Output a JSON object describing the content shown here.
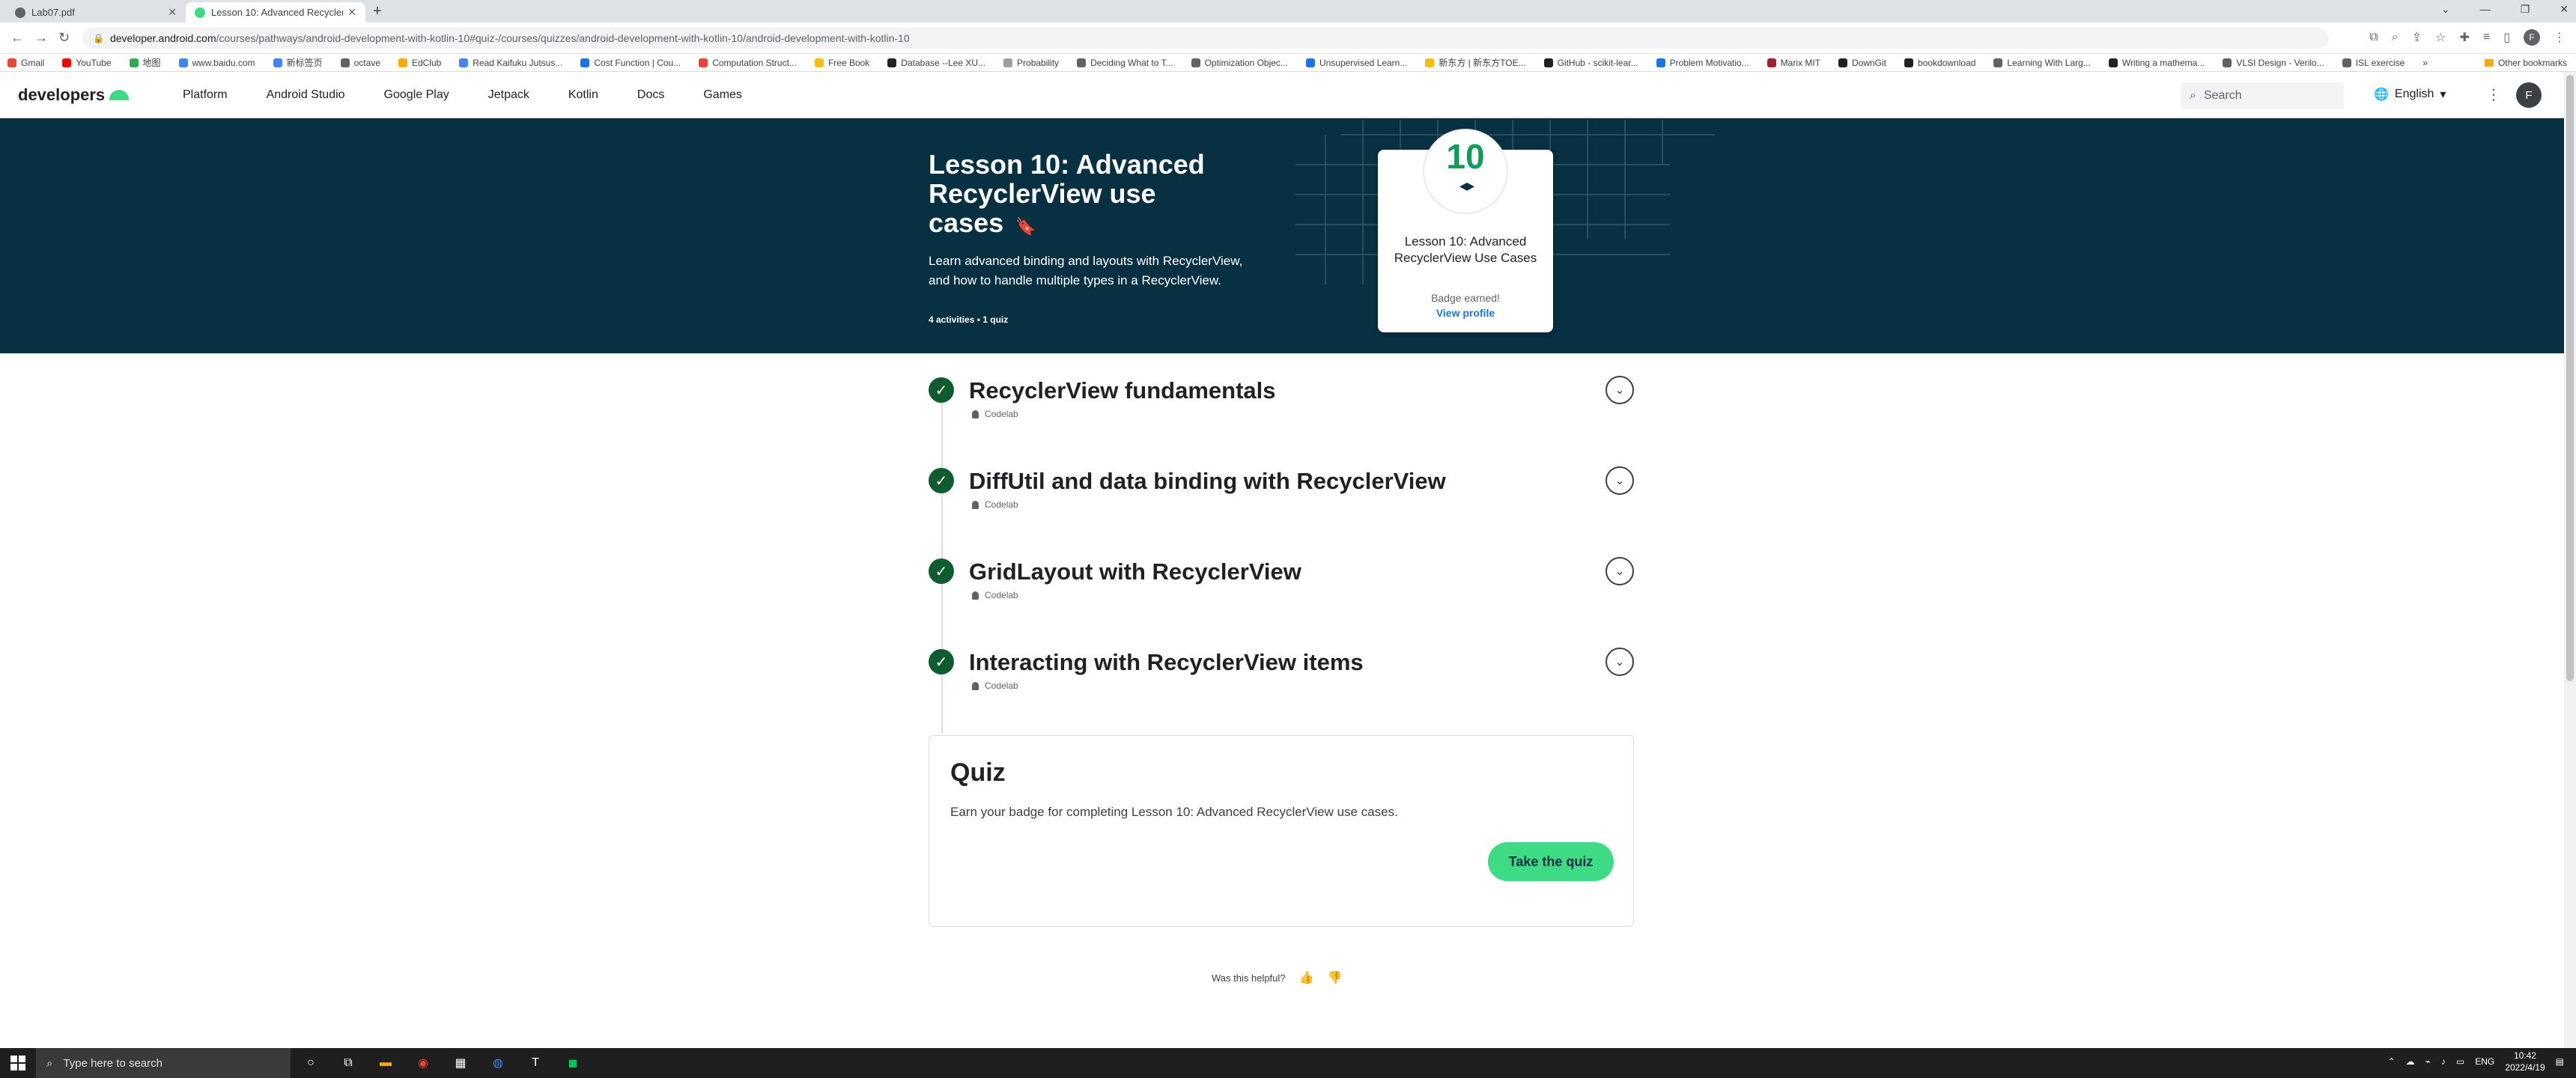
{
  "browser": {
    "tabs": [
      {
        "title": "Lab07.pdf",
        "active": false
      },
      {
        "title": "Lesson 10: Advanced RecyclerVie",
        "active": true
      }
    ],
    "new_tab": "+",
    "url_host": "developer.android.com",
    "url_path": "/courses/pathways/android-development-with-kotlin-10#quiz-/courses/quizzes/android-development-with-kotlin-10/android-development-with-kotlin-10",
    "profile_initial": "F",
    "bookmarks": [
      "Gmail",
      "YouTube",
      "地图",
      "www.baidu.com",
      "新标签页",
      "octave",
      "EdClub",
      "Read Kaifuku Jutsus...",
      "Cost Function | Cou...",
      "Computation Struct...",
      "Free Book",
      "Database --Lee XU...",
      "Probability",
      "Deciding What to T...",
      "Optimization Objec...",
      "Unsupervised Learn...",
      "新东方 | 新东方TOE...",
      "GitHub - scikit-lear...",
      "Problem Motivatio...",
      "Marix MIT",
      "DownGit",
      "bookdownload",
      "Learning With Larg...",
      "Writing a mathema...",
      "VLSI Design - Verilo...",
      "ISL exercise"
    ],
    "bookmarks_more": "»",
    "other_bookmarks": "Other bookmarks"
  },
  "site": {
    "logo": "developers",
    "nav": [
      "Platform",
      "Android Studio",
      "Google Play",
      "Jetpack",
      "Kotlin",
      "Docs",
      "Games"
    ],
    "search_placeholder": "Search",
    "language": "English",
    "avatar_initial": "F"
  },
  "hero": {
    "title": "Lesson 10: Advanced RecyclerView use cases",
    "description": "Learn advanced binding and layouts with RecyclerView, and how to handle multiple types in a RecyclerView.",
    "meta": "4 activities • 1 quiz",
    "badge": {
      "number": "10",
      "title": "Lesson 10: Advanced RecyclerView Use Cases",
      "status": "Badge earned!",
      "link": "View profile"
    }
  },
  "activities": [
    {
      "title": "RecyclerView fundamentals",
      "type": "Codelab",
      "completed": true
    },
    {
      "title": "DiffUtil and data binding with RecyclerView",
      "type": "Codelab",
      "completed": true
    },
    {
      "title": "GridLayout with RecyclerView",
      "type": "Codelab",
      "completed": true
    },
    {
      "title": "Interacting with RecyclerView items",
      "type": "Codelab",
      "completed": true
    }
  ],
  "quiz": {
    "title": "Quiz",
    "description": "Earn your badge for completing Lesson 10: Advanced RecyclerView use cases.",
    "button": "Take the quiz"
  },
  "feedback": {
    "label": "Was this helpful?"
  },
  "taskbar": {
    "search_placeholder": "Type here to search",
    "language": "ENG",
    "time": "10:42",
    "date": "2022/4/19"
  },
  "colors": {
    "hero_bg": "#073042",
    "accent_green": "#3ddc84",
    "check_green": "#0f5c31",
    "link_blue": "#1a73e8"
  }
}
